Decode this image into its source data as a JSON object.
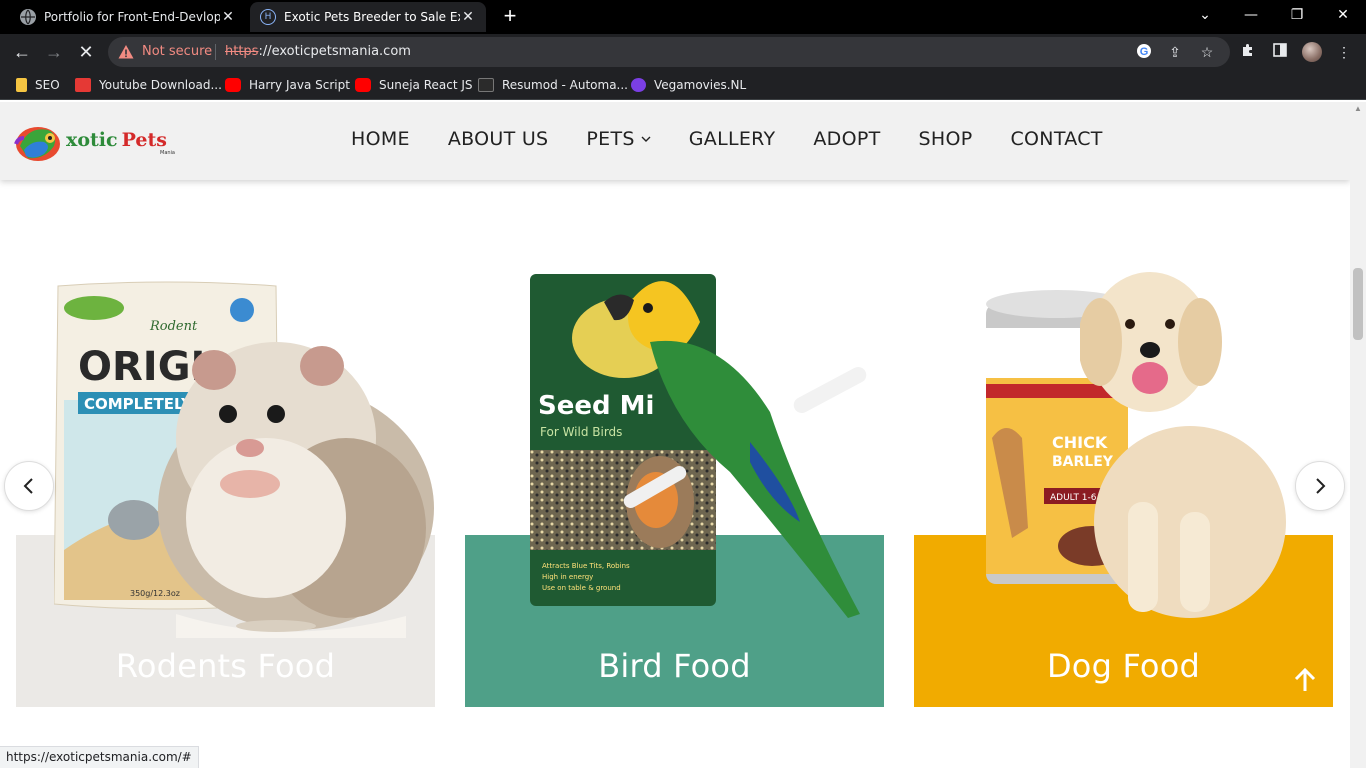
{
  "browser": {
    "tabs": [
      {
        "title": "Portfolio for Front-End-Devloper",
        "active": false
      },
      {
        "title": "Exotic Pets Breeder to Sale Exotic",
        "active": true
      }
    ],
    "security_label": "Not secure",
    "url_scheme": "https",
    "url_rest": "://exoticpetsmania.com",
    "bookmarks": [
      {
        "label": "SEO",
        "icon": "folder-icon",
        "color": "#f5c542"
      },
      {
        "label": "Youtube Download...",
        "icon": "download-icon",
        "color": "#e53935"
      },
      {
        "label": "Harry Java Script",
        "icon": "youtube-icon",
        "color": "#ff0000"
      },
      {
        "label": "Suneja React JS",
        "icon": "youtube-icon",
        "color": "#ff0000"
      },
      {
        "label": "Resumod - Automa...",
        "icon": "page-icon",
        "color": "#2b2b2b"
      },
      {
        "label": "Vegamovies.NL",
        "icon": "v-logo-icon",
        "color": "#7b3fe4"
      }
    ],
    "status_url": "https://exoticpetsmania.com/#"
  },
  "site": {
    "logo": {
      "first": "xotic",
      "second": "Pets",
      "sub": "Mania"
    },
    "nav": [
      "HOME",
      "ABOUT US",
      "PETS",
      "GALLERY",
      "ADOPT",
      "SHOP",
      "CONTACT"
    ],
    "cards": [
      {
        "label": "Rodents Food",
        "color": "#ebe9e6"
      },
      {
        "label": "Bird Food",
        "color": "#4fa088"
      },
      {
        "label": "Dog Food",
        "color": "#f1ab00"
      }
    ],
    "products": {
      "rodent_bag_brand": "Rodent",
      "rodent_bag_title": "ORIGI",
      "rodent_bag_sub": "COMPLETELY B",
      "rodent_bag_weight": "350g/12.3oz",
      "bird_bag_title": "Seed Mi",
      "bird_bag_sub": "For Wild Birds",
      "bird_bag_notes": [
        "Attracts Blue Tits, Robins",
        "High in energy",
        "Use on table & ground"
      ],
      "dog_can_title": "CHICK",
      "dog_can_sub": "BARLEY",
      "dog_can_badge": "ADULT 1-6"
    }
  }
}
